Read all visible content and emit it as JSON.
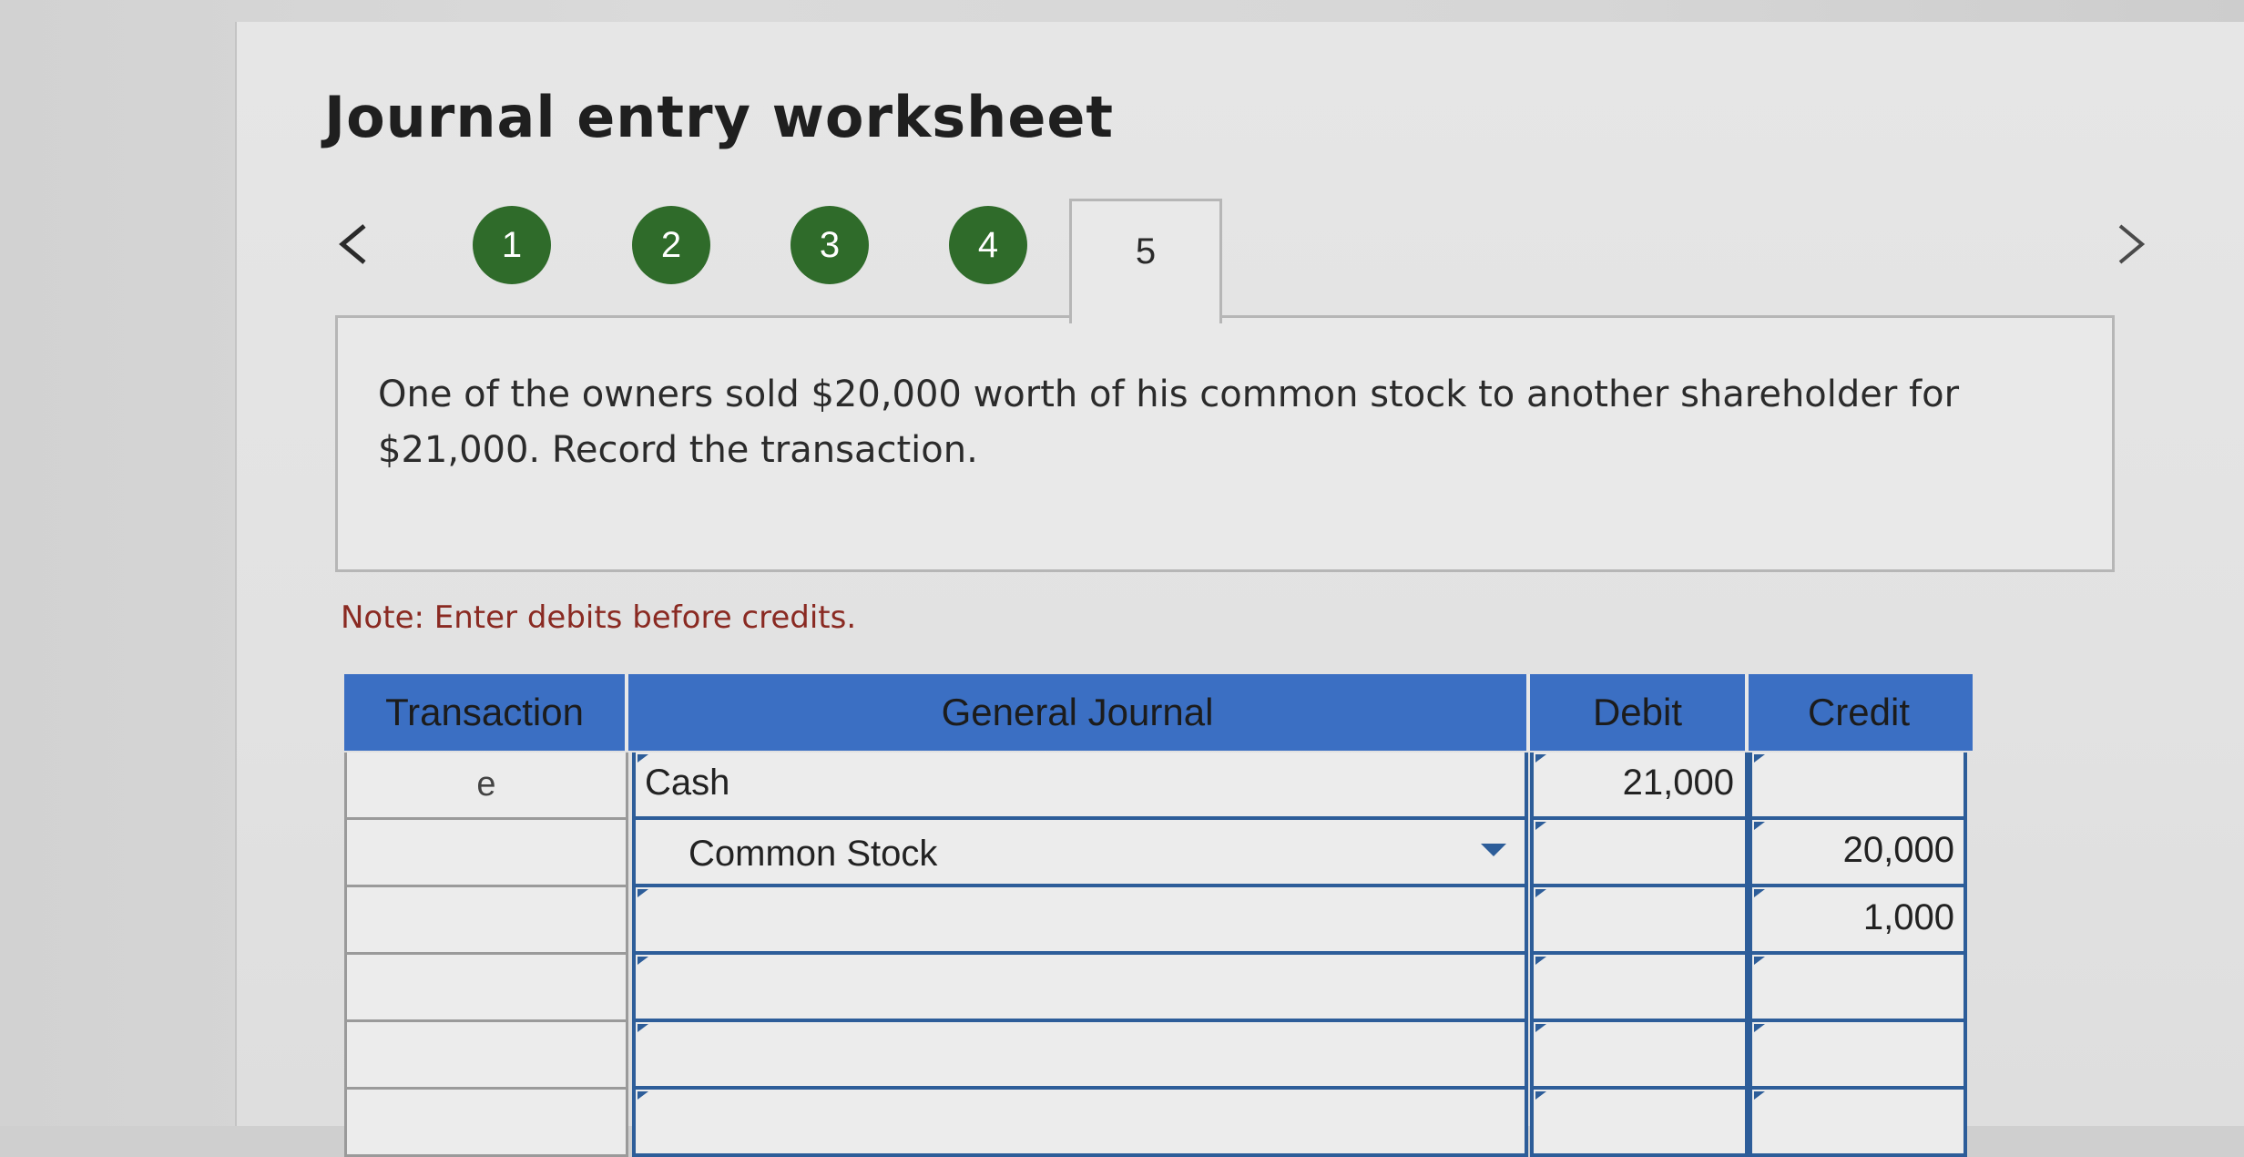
{
  "worksheet": {
    "title": "Journal entry worksheet",
    "steps": [
      "1",
      "2",
      "3",
      "4"
    ],
    "current_step": "5",
    "prev_icon": "chevron-left-icon",
    "next_icon": "chevron-right-icon"
  },
  "question": {
    "text": "One of the owners sold $20,000 worth of his common stock to another shareholder for $21,000. Record the transaction."
  },
  "note": "Note: Enter debits before credits.",
  "journal": {
    "headers": {
      "transaction": "Transaction",
      "general_journal": "General Journal",
      "debit": "Debit",
      "credit": "Credit"
    },
    "rows": [
      {
        "transaction": "e",
        "account": "Cash",
        "debit": "21,000",
        "credit": ""
      },
      {
        "transaction": "",
        "account": "Common Stock",
        "debit": "",
        "credit": "20,000"
      },
      {
        "transaction": "",
        "account": "",
        "debit": "",
        "credit": "1,000"
      },
      {
        "transaction": "",
        "account": "",
        "debit": "",
        "credit": ""
      },
      {
        "transaction": "",
        "account": "",
        "debit": "",
        "credit": ""
      },
      {
        "transaction": "",
        "account": "",
        "debit": "",
        "credit": ""
      }
    ]
  },
  "colors": {
    "step_complete": "#2f6b2a",
    "header_bg": "#3b6fc3",
    "note_text": "#8a2a22"
  }
}
